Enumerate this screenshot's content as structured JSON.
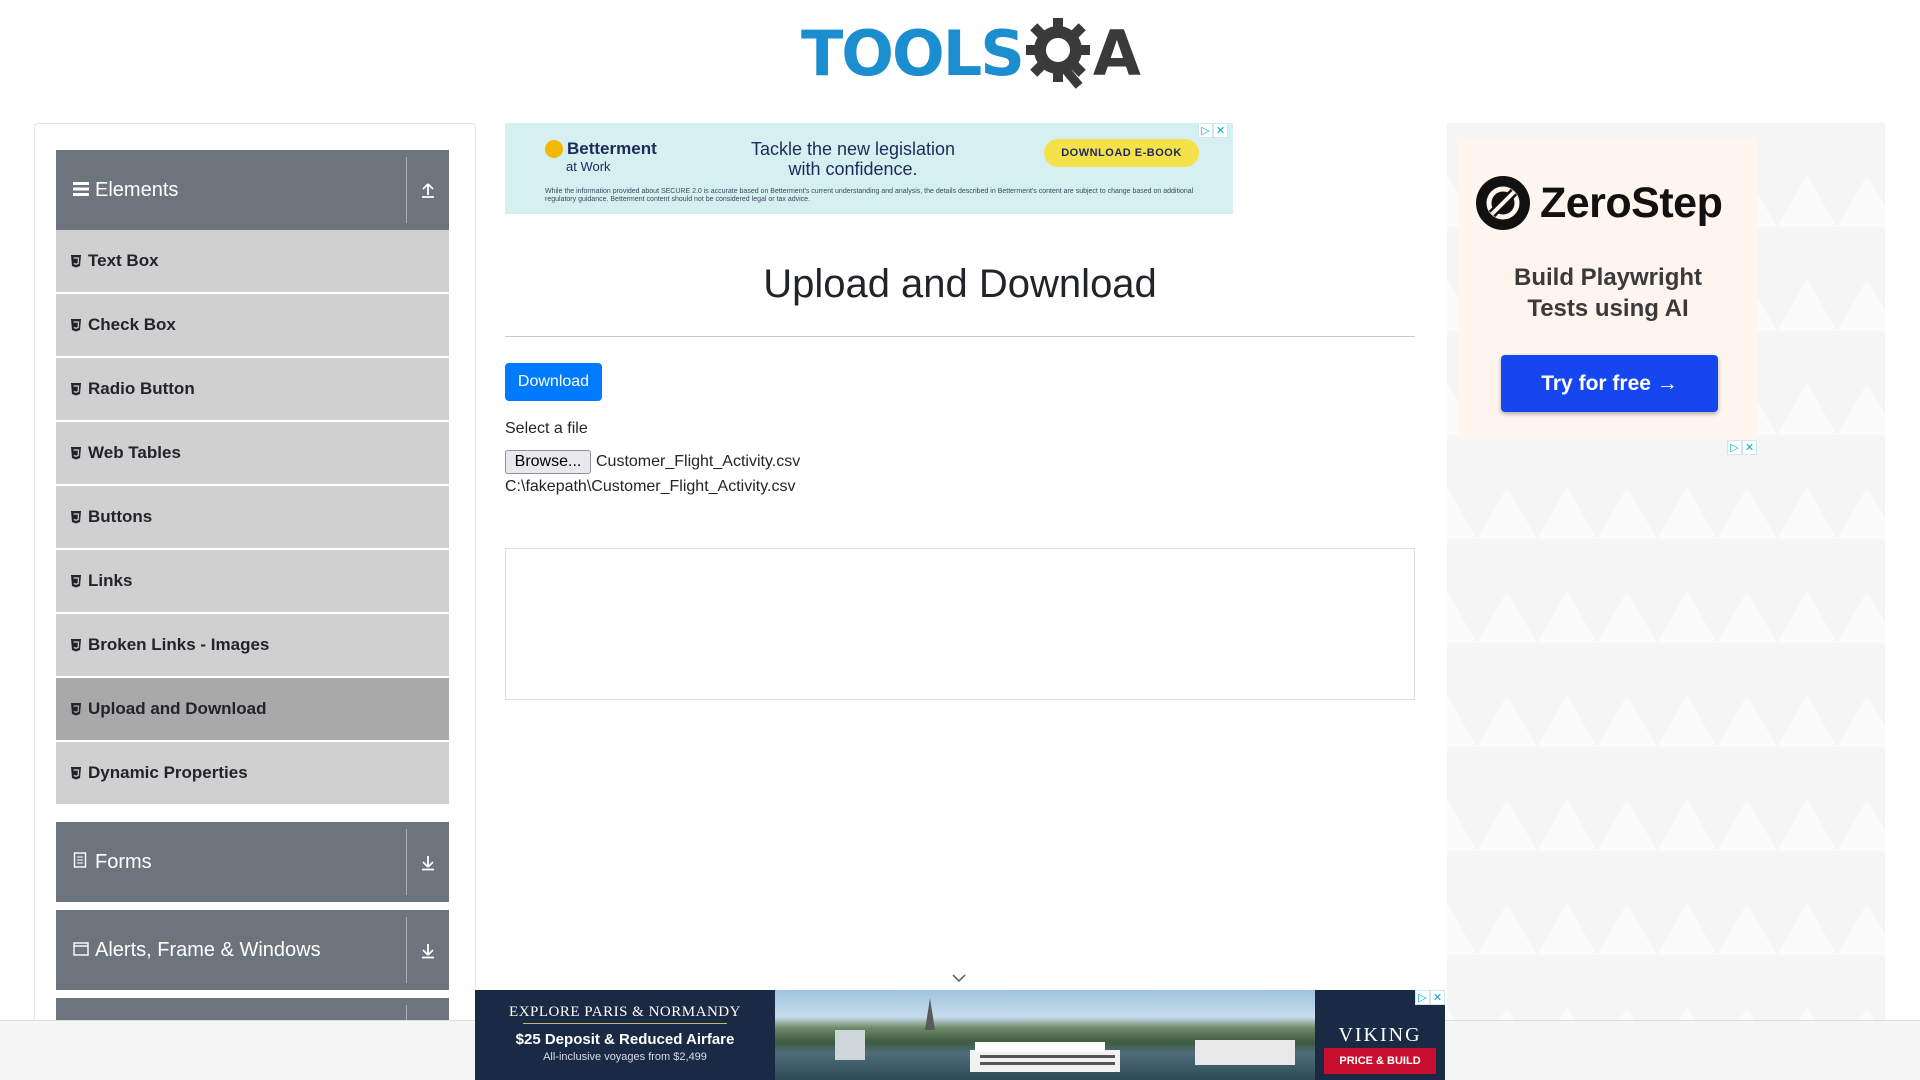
{
  "logo": {
    "text_a": "TOOLS",
    "text_b": "A"
  },
  "sidebar": {
    "groups": [
      {
        "label": "Elements",
        "icon": "hamburger-icon",
        "toggle_icon": "collapse-up-icon"
      },
      {
        "label": "Forms",
        "icon": "document-icon",
        "toggle_icon": "expand-down-icon"
      },
      {
        "label": "Alerts, Frame & Windows",
        "icon": "window-icon",
        "toggle_icon": "expand-down-icon"
      }
    ],
    "items": [
      {
        "label": "Text Box"
      },
      {
        "label": "Check Box"
      },
      {
        "label": "Radio Button"
      },
      {
        "label": "Web Tables"
      },
      {
        "label": "Buttons"
      },
      {
        "label": "Links"
      },
      {
        "label": "Broken Links - Images"
      },
      {
        "label": "Upload and Download",
        "active": true
      },
      {
        "label": "Dynamic Properties"
      }
    ]
  },
  "ad_top": {
    "brand": "Betterment",
    "brand_sub": "at Work",
    "headline": "Tackle the new legislation with confidence.",
    "cta": "DOWNLOAD E-BOOK",
    "fine_print": "While the information provided about SECURE 2.0 is accurate based on Betterment's current understanding and analysis, the details described in Betterment's content are subject to change based on additional regulatory guidance. Betterment content should not be considered legal or tax advice."
  },
  "main": {
    "title": "Upload and Download",
    "download_button": "Download",
    "select_label": "Select a file",
    "browse_button": "Browse...",
    "file_name": "Customer_Flight_Activity.csv",
    "file_path": "C:\\fakepath\\Customer_Flight_Activity.csv"
  },
  "ad_right": {
    "brand": "ZeroStep",
    "tagline_line1": "Build Playwright",
    "tagline_line2": "Tests using AI",
    "cta": "Try for free →"
  },
  "ad_bottom": {
    "headline": "EXPLORE PARIS & NORMANDY",
    "offer": "$25 Deposit & Reduced Airfare",
    "small": "All-inclusive voyages from $2,499",
    "brand": "VIKING",
    "cta": "PRICE & BUILD"
  },
  "colors": {
    "primary": "#007bff",
    "group_header": "#6c757d",
    "menu_item": "#d0d0d0",
    "menu_item_active": "#a9a9a9",
    "logo_blue": "#1a8ecf"
  }
}
